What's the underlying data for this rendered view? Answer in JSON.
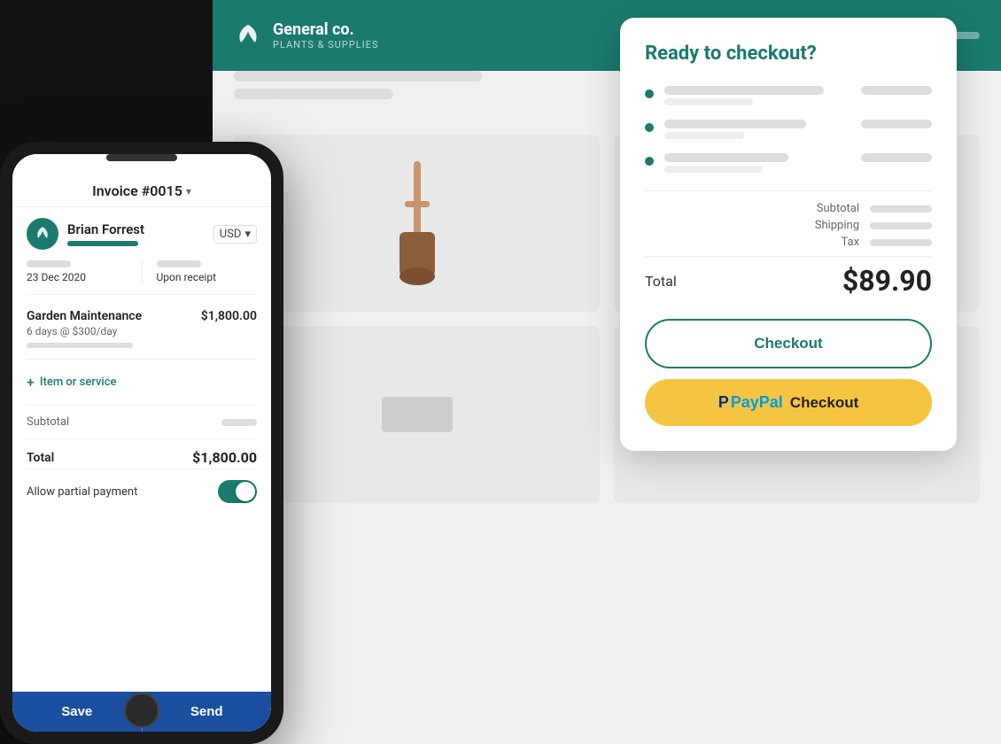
{
  "app": {
    "company_name": "General co.",
    "company_sub": "PLANTS & SUPPLIES",
    "header_bars": [
      "120px",
      "140px"
    ]
  },
  "invoice": {
    "title": "Invoice #0015",
    "client_name": "Brian Forrest",
    "currency": "USD",
    "date": "23 Dec 2020",
    "due": "Upon receipt",
    "line_items": [
      {
        "name": "Garden Maintenance",
        "amount": "$1,800.00",
        "description": "6 days @ $300/day"
      }
    ],
    "add_item_label": "Item or service",
    "subtotal_label": "Subtotal",
    "total_label": "Total",
    "total_value": "$1,800.00",
    "partial_payment_label": "Allow partial payment",
    "save_label": "Save",
    "send_label": "Send"
  },
  "modal": {
    "title": "Ready to checkout?",
    "subtotal_label": "Subtotal",
    "shipping_label": "Shipping",
    "tax_label": "Tax",
    "total_label": "Total",
    "total_amount": "$89.90",
    "checkout_label": "Checkout",
    "paypal_checkout_label": "Checkout"
  }
}
